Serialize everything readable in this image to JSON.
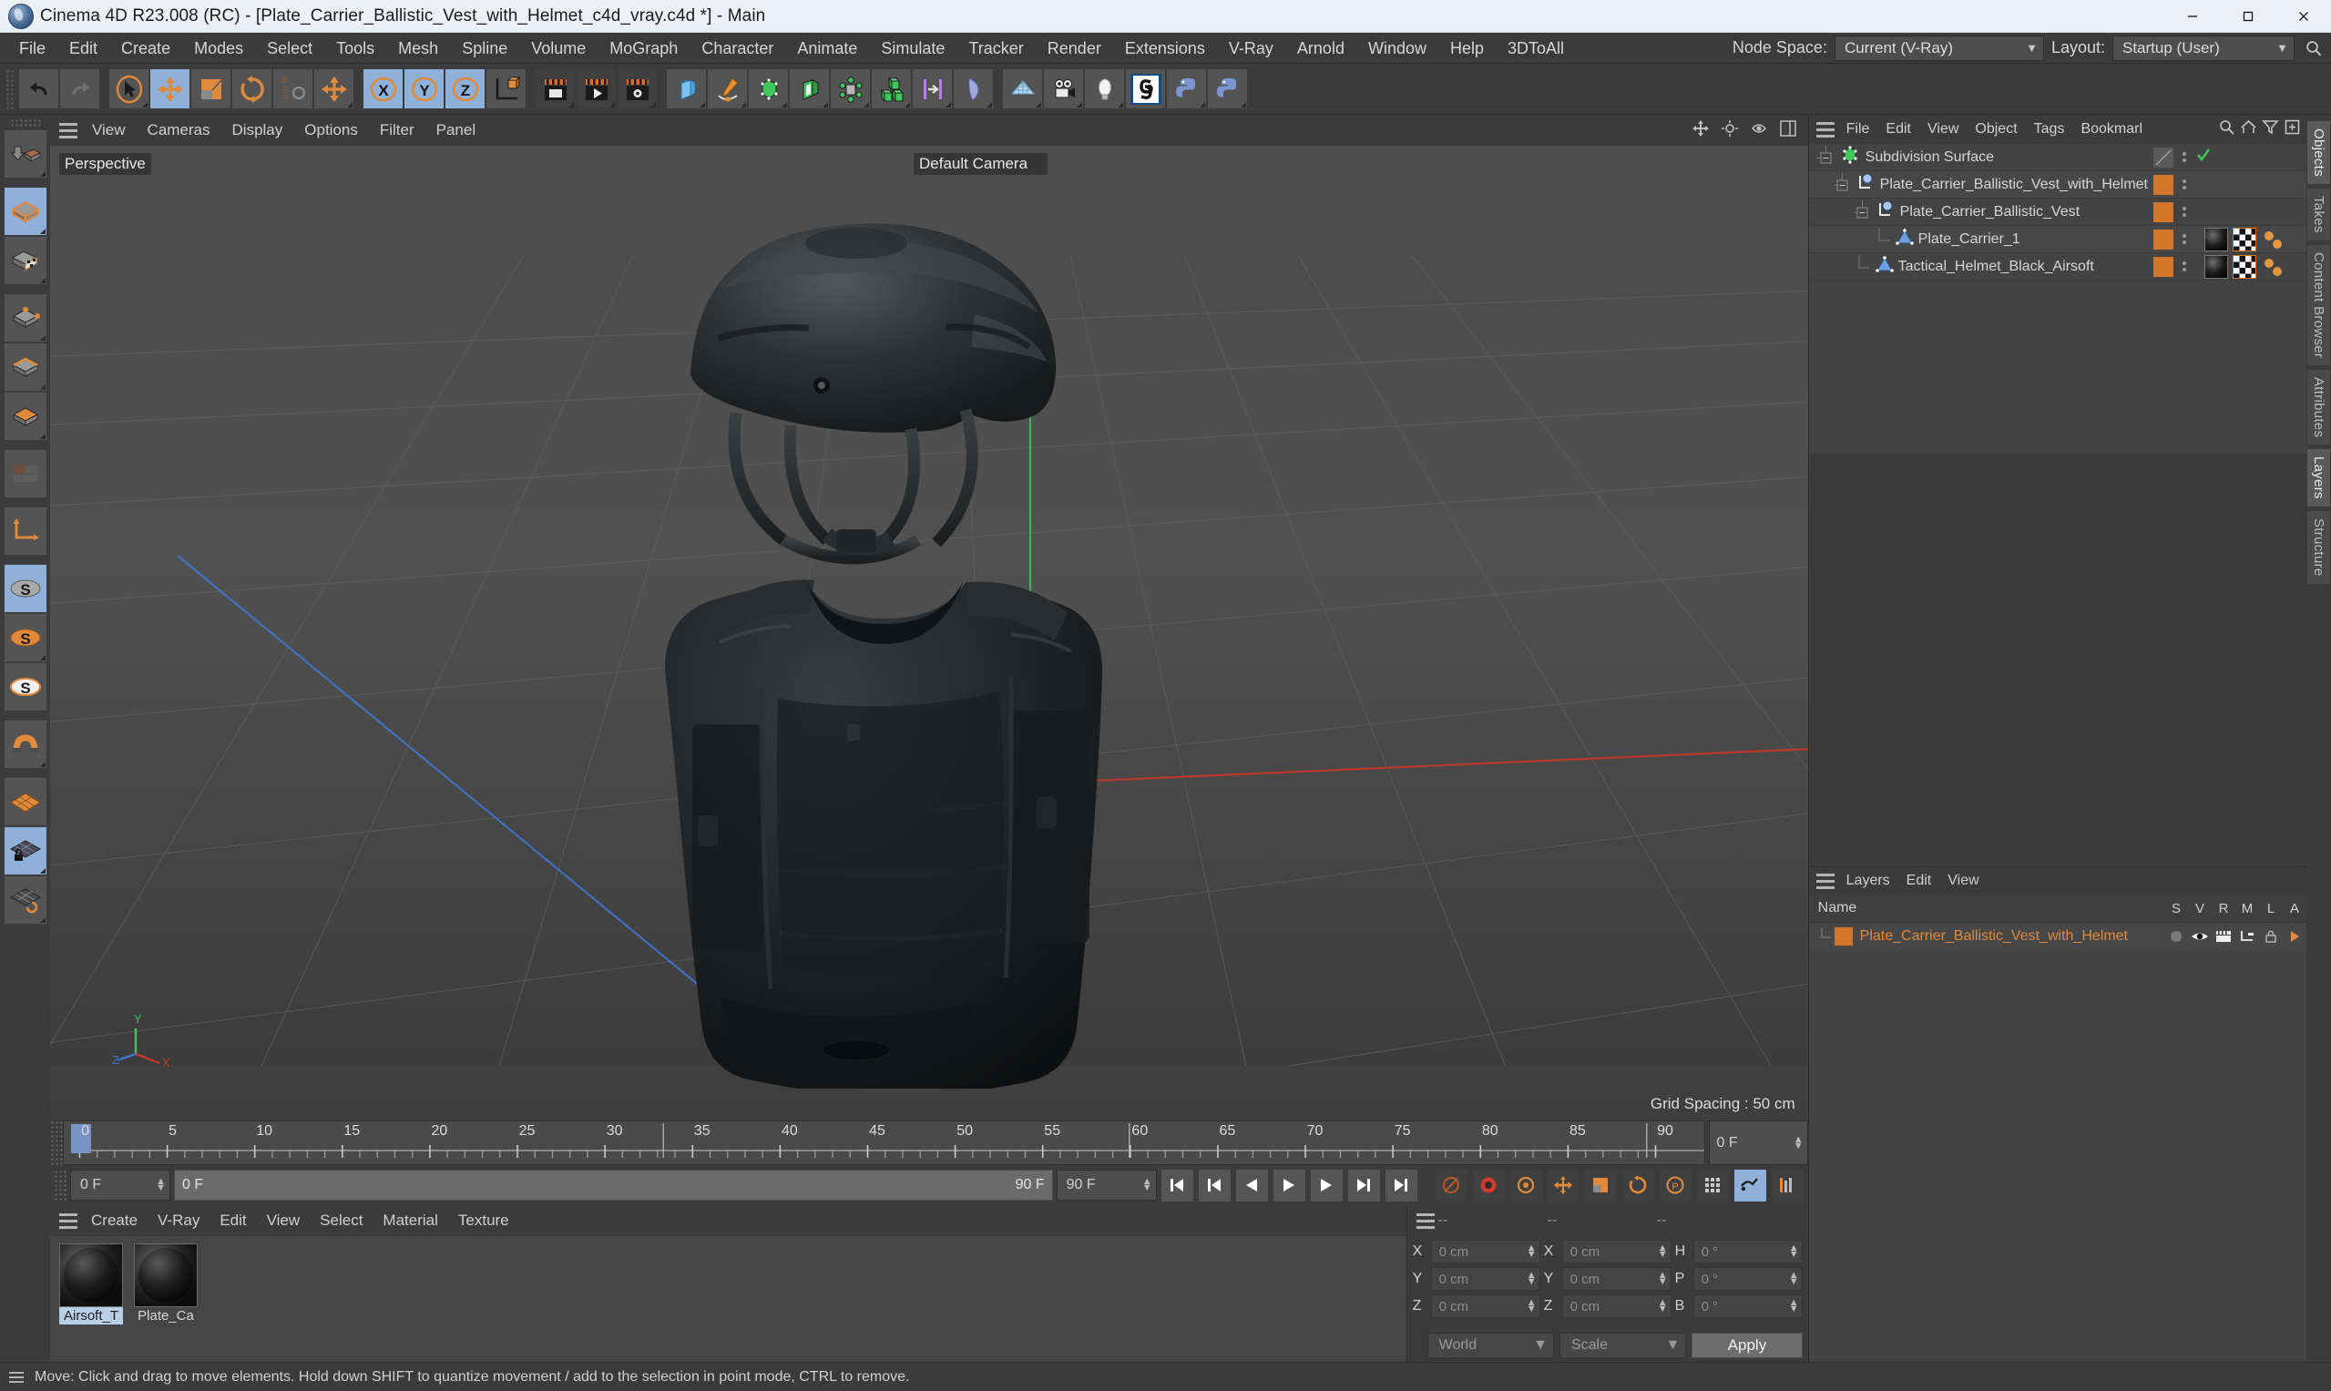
{
  "window": {
    "title": "Cinema 4D R23.008 (RC) - [Plate_Carrier_Ballistic_Vest_with_Helmet_c4d_vray.c4d *] - Main",
    "minimize": "minimize-icon",
    "maximize": "maximize-icon",
    "close": "close-icon"
  },
  "menubar": {
    "items": [
      "File",
      "Edit",
      "Create",
      "Modes",
      "Select",
      "Tools",
      "Mesh",
      "Spline",
      "Volume",
      "MoGraph",
      "Character",
      "Animate",
      "Simulate",
      "Tracker",
      "Render",
      "Extensions",
      "V-Ray",
      "Arnold",
      "Window",
      "Help",
      "3DToAll"
    ],
    "node_space_label": "Node Space:",
    "node_space_value": "Current (V-Ray)",
    "layout_label": "Layout:",
    "layout_value": "Startup (User)"
  },
  "toolbar": {
    "buttons": [
      {
        "name": "undo",
        "icon": "undo-icon",
        "state": "normal"
      },
      {
        "name": "redo",
        "icon": "redo-icon",
        "state": "disabled"
      },
      {
        "name": "live-selection",
        "icon": "selection-cursor-icon",
        "state": "normal"
      },
      {
        "name": "move",
        "icon": "move-arrows-icon",
        "state": "selected"
      },
      {
        "name": "scale",
        "icon": "scale-icon",
        "state": "normal"
      },
      {
        "name": "rotate",
        "icon": "rotate-icon",
        "state": "normal"
      },
      {
        "name": "psr-reset",
        "icon": "psr-icon",
        "state": "disabled"
      },
      {
        "name": "move-duplicate",
        "icon": "move-arrows-icon",
        "state": "normal"
      },
      {
        "name": "axis-x",
        "icon": "x-axis-icon",
        "state": "selected"
      },
      {
        "name": "axis-y",
        "icon": "y-axis-icon",
        "state": "selected"
      },
      {
        "name": "axis-z",
        "icon": "z-axis-icon",
        "state": "selected"
      },
      {
        "name": "world-object-axis",
        "icon": "world-axis-icon",
        "state": "normal"
      },
      {
        "name": "render-view",
        "icon": "render-view-icon",
        "state": "dark"
      },
      {
        "name": "render-to-picture-viewer",
        "icon": "render-picture-icon",
        "state": "dark"
      },
      {
        "name": "render-settings",
        "icon": "render-settings-icon",
        "state": "dark"
      },
      {
        "name": "cube",
        "icon": "cube-primitive-icon",
        "state": "normal"
      },
      {
        "name": "pen-spline",
        "icon": "pen-spline-icon",
        "state": "normal"
      },
      {
        "name": "subdivision-surface",
        "icon": "subdivision-surface-icon",
        "state": "normal"
      },
      {
        "name": "bend-deformer",
        "icon": "bend-deformer-icon",
        "state": "normal"
      },
      {
        "name": "mograph-cloner",
        "icon": "mograph-cloner-icon",
        "state": "normal"
      },
      {
        "name": "array",
        "icon": "array-icon",
        "state": "normal"
      },
      {
        "name": "mograph-effector",
        "icon": "effector-icon",
        "state": "normal"
      },
      {
        "name": "field",
        "icon": "field-icon",
        "state": "normal"
      },
      {
        "name": "floor-environment",
        "icon": "floor-grid-icon",
        "state": "normal"
      },
      {
        "name": "camera",
        "icon": "camera-icon",
        "state": "normal"
      },
      {
        "name": "light",
        "icon": "light-bulb-icon",
        "state": "normal"
      },
      {
        "name": "cinema4d-tag",
        "icon": "c4d-logo-icon",
        "state": "normal"
      },
      {
        "name": "python-generator",
        "icon": "python-icon",
        "state": "normal"
      },
      {
        "name": "python-tag",
        "icon": "python-icon",
        "state": "normal"
      }
    ]
  },
  "left_toolbar": {
    "buttons": [
      {
        "name": "make-editable",
        "icon": "make-editable-icon",
        "state": "normal"
      },
      {
        "name": "model-mode",
        "icon": "model-mode-icon",
        "state": "selected"
      },
      {
        "name": "texture-mode",
        "icon": "texture-mode-icon",
        "state": "normal"
      },
      {
        "name": "points-mode",
        "icon": "points-mode-icon",
        "state": "normal"
      },
      {
        "name": "edges-mode",
        "icon": "edges-mode-icon",
        "state": "normal"
      },
      {
        "name": "polygons-mode",
        "icon": "polygons-mode-icon",
        "state": "normal"
      },
      {
        "name": "uv-mode",
        "icon": "uv-mode-icon",
        "state": "disabled"
      },
      {
        "name": "object-axis-mode",
        "icon": "axis-mode-icon",
        "state": "normal"
      },
      {
        "name": "enable-snap",
        "icon": "snap-s-grey-icon",
        "state": "selected"
      },
      {
        "name": "snap-settings",
        "icon": "snap-s-orange-icon",
        "state": "normal"
      },
      {
        "name": "snap-options",
        "icon": "snap-s-white-icon",
        "state": "normal"
      },
      {
        "name": "magnet",
        "icon": "magnet-icon",
        "state": "normal"
      },
      {
        "name": "workplane",
        "icon": "workplane-icon",
        "state": "normal"
      },
      {
        "name": "lock-workplane",
        "icon": "workplane-lock-icon",
        "state": "selected"
      },
      {
        "name": "planar-workplane",
        "icon": "workplane-rotate-icon",
        "state": "normal"
      }
    ]
  },
  "viewport": {
    "menus": [
      "View",
      "Cameras",
      "Display",
      "Options",
      "Filter",
      "Panel"
    ],
    "label_topleft": "Perspective",
    "label_topright": "Default Camera",
    "grid_spacing": "Grid Spacing : 50 cm",
    "axis_labels": {
      "x": "X",
      "y": "Y",
      "z": "Z"
    },
    "right_icons": [
      "move-view-icon",
      "pan-view-icon",
      "zoom-view-icon",
      "panel-layout-icon"
    ]
  },
  "timeline": {
    "ticks": [
      "0",
      "5",
      "10",
      "15",
      "20",
      "25",
      "30",
      "35",
      "40",
      "45",
      "50",
      "55",
      "60",
      "65",
      "70",
      "75",
      "80",
      "85",
      "90"
    ],
    "current_frame_marker": "0",
    "end_field": "0 F"
  },
  "transport": {
    "current_frame": "0 F",
    "range_start": "0 F",
    "range_end": "90 F",
    "preview_end": "90 F",
    "buttons": [
      {
        "name": "go-to-start",
        "icon": "skip-start-icon"
      },
      {
        "name": "go-to-previous-key",
        "icon": "prev-key-icon"
      },
      {
        "name": "step-back",
        "icon": "step-back-icon"
      },
      {
        "name": "play-forward",
        "icon": "play-icon"
      },
      {
        "name": "step-forward",
        "icon": "step-forward-icon"
      },
      {
        "name": "go-to-next-key",
        "icon": "next-key-icon"
      },
      {
        "name": "go-to-end",
        "icon": "skip-end-icon"
      },
      {
        "name": "record-active-objects",
        "icon": "record-disabled-icon"
      },
      {
        "name": "autokeying",
        "icon": "autokey-icon"
      },
      {
        "name": "keyframe-selection",
        "icon": "keyframe-selection-icon"
      },
      {
        "name": "position-key",
        "icon": "position-key-icon"
      },
      {
        "name": "scale-key",
        "icon": "scale-key-icon"
      },
      {
        "name": "rotation-key",
        "icon": "rotation-key-icon"
      },
      {
        "name": "parameter-key",
        "icon": "parameter-key-icon"
      },
      {
        "name": "point-level-animation",
        "icon": "pla-icon"
      },
      {
        "name": "animation-mode",
        "icon": "animation-mode-icon"
      },
      {
        "name": "timeline-view",
        "icon": "timeline-view-icon"
      }
    ]
  },
  "material_manager": {
    "menus": [
      "Create",
      "V-Ray",
      "Edit",
      "View",
      "Select",
      "Material",
      "Texture"
    ],
    "materials": [
      {
        "name": "Airsoft_T",
        "selected": true
      },
      {
        "name": "Plate_Ca",
        "selected": false
      }
    ]
  },
  "coordinates": {
    "header": [
      "--",
      "--",
      "--"
    ],
    "rows": [
      {
        "label_pos": "X",
        "value_pos": "0 cm",
        "label_size": "X",
        "value_size": "0 cm",
        "label_rot": "H",
        "value_rot": "0 °"
      },
      {
        "label_pos": "Y",
        "value_pos": "0 cm",
        "label_size": "Y",
        "value_size": "0 cm",
        "label_rot": "P",
        "value_rot": "0 °"
      },
      {
        "label_pos": "Z",
        "value_pos": "0 cm",
        "label_size": "Z",
        "value_size": "0 cm",
        "label_rot": "B",
        "value_rot": "0 °"
      }
    ],
    "coord_system": "World",
    "transform_mode": "Scale",
    "apply_label": "Apply"
  },
  "object_manager": {
    "menus": [
      "File",
      "Edit",
      "View",
      "Object",
      "Tags",
      "Bookmarl"
    ],
    "tools": [
      "search-icon",
      "home-icon",
      "filter-icon",
      "add-layer-icon"
    ],
    "rows": [
      {
        "name": "Subdivision Surface",
        "depth": 0,
        "icon": "subdivision-surface-icon",
        "swatch": false,
        "check": true,
        "tags": []
      },
      {
        "name": "Plate_Carrier_Ballistic_Vest_with_Helmet",
        "depth": 1,
        "icon": "null-object-icon",
        "swatch": true,
        "check": false,
        "tags": []
      },
      {
        "name": "Plate_Carrier_Ballistic_Vest",
        "depth": 2,
        "icon": "null-object-icon",
        "swatch": true,
        "check": false,
        "tags": []
      },
      {
        "name": "Plate_Carrier_1",
        "depth": 3,
        "icon": "polygon-object-icon",
        "swatch": true,
        "check": false,
        "tags": [
          "material-tag",
          "uvw-tag",
          "selection-tag"
        ]
      },
      {
        "name": "Tactical_Helmet_Black_Airsoft",
        "depth": 2,
        "icon": "polygon-object-icon",
        "swatch": true,
        "check": false,
        "tags": [
          "material-tag",
          "uvw-tag",
          "selection-tag"
        ]
      }
    ]
  },
  "layer_manager": {
    "menus": [
      "Layers",
      "Edit",
      "View"
    ],
    "columns": [
      "Name",
      "S",
      "V",
      "R",
      "M",
      "L",
      "A"
    ],
    "rows": [
      {
        "name": "Plate_Carrier_Ballistic_Vest_with_Helmet",
        "color": "#d2762a"
      }
    ]
  },
  "right_tabs": [
    "Objects",
    "Takes",
    "Content Browser",
    "Attributes",
    "Layers",
    "Structure"
  ],
  "statusbar": {
    "text": "Move: Click and drag to move elements. Hold down SHIFT to quantize movement / add to the selection in point mode, CTRL to remove."
  },
  "colors": {
    "accent_orange": "#d2762a",
    "selected_blue": "#8fb0d8",
    "panel_bg": "#3b3b3b",
    "list_bg": "#434343",
    "green_check": "#3ec75a"
  }
}
